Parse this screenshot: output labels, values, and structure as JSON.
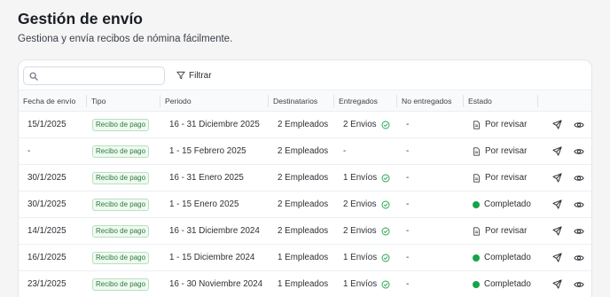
{
  "header": {
    "title": "Gestión de envío",
    "subtitle": "Gestiona y envía recibos de nómina fácilmente."
  },
  "toolbar": {
    "search_value": "",
    "search_placeholder": "",
    "filter_label": "Filtrar"
  },
  "table": {
    "columns": [
      "Fecha de envío",
      "Tipo",
      "Periodo",
      "Destinatarios",
      "Entregados",
      "No entregados",
      "Estado",
      ""
    ],
    "rows": [
      {
        "fecha": "15/1/2025",
        "tipo": "Recibo de pago",
        "periodo": "16 - 31 Diciembre 2025",
        "destinatarios": "2 Empleados",
        "entregados": "2 Envios",
        "entregados_check": true,
        "no_entregados": "-",
        "estado": "Por revisar",
        "estado_kind": "review"
      },
      {
        "fecha": "-",
        "tipo": "Recibo de pago",
        "periodo": "1 - 15 Febrero 2025",
        "destinatarios": "2 Empleados",
        "entregados": "-",
        "entregados_check": false,
        "no_entregados": "-",
        "estado": "Por revisar",
        "estado_kind": "review"
      },
      {
        "fecha": "30/1/2025",
        "tipo": "Recibo de pago",
        "periodo": "16 - 31 Enero 2025",
        "destinatarios": "2 Empleados",
        "entregados": "1 Envíos",
        "entregados_check": true,
        "no_entregados": "-",
        "estado": "Por revisar",
        "estado_kind": "review"
      },
      {
        "fecha": "30/1/2025",
        "tipo": "Recibo de pago",
        "periodo": "1 - 15 Enero 2025",
        "destinatarios": "2 Empleados",
        "entregados": "2 Envios",
        "entregados_check": true,
        "no_entregados": "-",
        "estado": "Completado",
        "estado_kind": "done"
      },
      {
        "fecha": "14/1/2025",
        "tipo": "Recibo de pago",
        "periodo": "16 - 31 Diciembre 2024",
        "destinatarios": "2 Empleados",
        "entregados": "2 Envios",
        "entregados_check": true,
        "no_entregados": "-",
        "estado": "Por revisar",
        "estado_kind": "review"
      },
      {
        "fecha": "16/1/2025",
        "tipo": "Recibo de pago",
        "periodo": "1 - 15 Diciembre 2024",
        "destinatarios": "1 Empleados",
        "entregados": "1 Envíos",
        "entregados_check": true,
        "no_entregados": "-",
        "estado": "Completado",
        "estado_kind": "done"
      },
      {
        "fecha": "23/1/2025",
        "tipo": "Recibo de pago",
        "periodo": "16 - 30 Noviembre 2024",
        "destinatarios": "1 Empleados",
        "entregados": "1 Envíos",
        "entregados_check": true,
        "no_entregados": "-",
        "estado": "Completado",
        "estado_kind": "done"
      }
    ]
  },
  "icons": {
    "search": "search-icon",
    "filter": "filter-icon",
    "check": "check-circle-icon",
    "review": "document-icon",
    "done": "status-dot-icon",
    "send": "send-icon",
    "view": "eye-icon"
  },
  "colors": {
    "badge_text": "#2b7a3a",
    "badge_border": "#b9dfc0",
    "badge_bg": "#effaf1",
    "check": "#22a64a",
    "done_dot": "#16a34a"
  }
}
